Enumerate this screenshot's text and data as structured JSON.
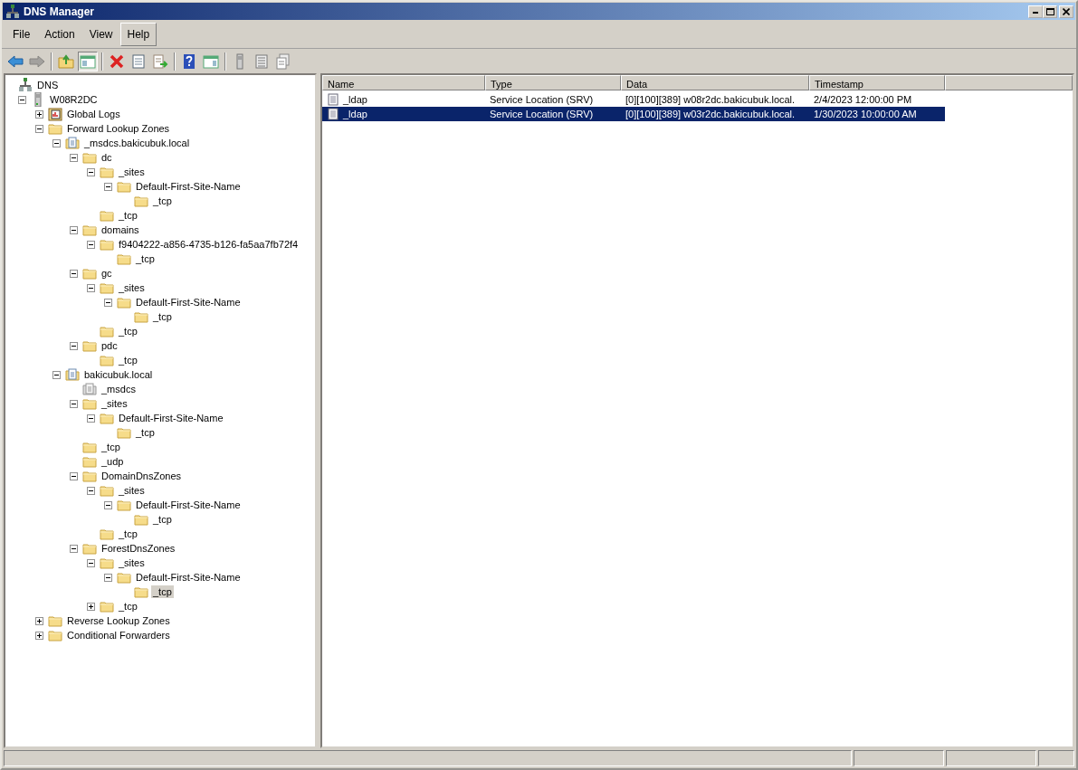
{
  "window": {
    "title": "DNS Manager"
  },
  "menu": [
    {
      "label": "File",
      "hot": false
    },
    {
      "label": "Action",
      "hot": false
    },
    {
      "label": "View",
      "hot": false
    },
    {
      "label": "Help",
      "hot": true
    }
  ],
  "toolbar": [
    {
      "kind": "back",
      "disabled": false,
      "pressed": false
    },
    {
      "kind": "forward",
      "disabled": true,
      "pressed": false
    },
    {
      "kind": "separator"
    },
    {
      "kind": "up",
      "disabled": false,
      "pressed": false
    },
    {
      "kind": "tree-toggle",
      "disabled": false,
      "pressed": true
    },
    {
      "kind": "separator"
    },
    {
      "kind": "delete",
      "disabled": false,
      "pressed": false
    },
    {
      "kind": "properties",
      "disabled": false,
      "pressed": false
    },
    {
      "kind": "export",
      "disabled": false,
      "pressed": false
    },
    {
      "kind": "separator"
    },
    {
      "kind": "help",
      "disabled": false,
      "pressed": false
    },
    {
      "kind": "action-pane",
      "disabled": false,
      "pressed": false
    },
    {
      "kind": "separator"
    },
    {
      "kind": "server",
      "disabled": false,
      "pressed": false
    },
    {
      "kind": "list",
      "disabled": false,
      "pressed": false
    },
    {
      "kind": "copy",
      "disabled": false,
      "pressed": false
    }
  ],
  "tree": [
    {
      "label": "DNS",
      "kind": "dns",
      "selected": false,
      "children": [
        {
          "label": "W08R2DC",
          "kind": "server",
          "expanded": true,
          "selected": false,
          "children": [
            {
              "label": "Global Logs",
              "kind": "logs",
              "expanded": false,
              "selected": false
            },
            {
              "label": "Forward Lookup Zones",
              "kind": "folder",
              "expanded": true,
              "selected": false,
              "children": [
                {
                  "label": "_msdcs.bakicubuk.local",
                  "kind": "zone",
                  "expanded": true,
                  "selected": false,
                  "children": [
                    {
                      "label": "dc",
                      "kind": "folder",
                      "expanded": true,
                      "selected": false,
                      "children": [
                        {
                          "label": "_sites",
                          "kind": "folder",
                          "expanded": true,
                          "selected": false,
                          "children": [
                            {
                              "label": "Default-First-Site-Name",
                              "kind": "folder",
                              "expanded": true,
                              "selected": false,
                              "children": [
                                {
                                  "label": "_tcp",
                                  "kind": "folder",
                                  "selected": false
                                }
                              ]
                            }
                          ]
                        },
                        {
                          "label": "_tcp",
                          "kind": "folder",
                          "selected": false
                        }
                      ]
                    },
                    {
                      "label": "domains",
                      "kind": "folder",
                      "expanded": true,
                      "selected": false,
                      "children": [
                        {
                          "label": "f9404222-a856-4735-b126-fa5aa7fb72f4",
                          "kind": "folder",
                          "expanded": true,
                          "selected": false,
                          "children": [
                            {
                              "label": "_tcp",
                              "kind": "folder",
                              "selected": false
                            }
                          ]
                        }
                      ]
                    },
                    {
                      "label": "gc",
                      "kind": "folder",
                      "expanded": true,
                      "selected": false,
                      "children": [
                        {
                          "label": "_sites",
                          "kind": "folder",
                          "expanded": true,
                          "selected": false,
                          "children": [
                            {
                              "label": "Default-First-Site-Name",
                              "kind": "folder",
                              "expanded": true,
                              "selected": false,
                              "children": [
                                {
                                  "label": "_tcp",
                                  "kind": "folder",
                                  "selected": false
                                }
                              ]
                            }
                          ]
                        },
                        {
                          "label": "_tcp",
                          "kind": "folder",
                          "selected": false
                        }
                      ]
                    },
                    {
                      "label": "pdc",
                      "kind": "folder",
                      "expanded": true,
                      "selected": false,
                      "children": [
                        {
                          "label": "_tcp",
                          "kind": "folder",
                          "selected": false
                        }
                      ]
                    }
                  ]
                },
                {
                  "label": "bakicubuk.local",
                  "kind": "zone",
                  "expanded": true,
                  "selected": false,
                  "children": [
                    {
                      "label": "_msdcs",
                      "kind": "zone-delegated",
                      "selected": false
                    },
                    {
                      "label": "_sites",
                      "kind": "folder",
                      "expanded": true,
                      "selected": false,
                      "children": [
                        {
                          "label": "Default-First-Site-Name",
                          "kind": "folder",
                          "expanded": true,
                          "selected": false,
                          "children": [
                            {
                              "label": "_tcp",
                              "kind": "folder",
                              "selected": false
                            }
                          ]
                        }
                      ]
                    },
                    {
                      "label": "_tcp",
                      "kind": "folder",
                      "selected": false
                    },
                    {
                      "label": "_udp",
                      "kind": "folder",
                      "selected": false
                    },
                    {
                      "label": "DomainDnsZones",
                      "kind": "folder",
                      "expanded": true,
                      "selected": false,
                      "children": [
                        {
                          "label": "_sites",
                          "kind": "folder",
                          "expanded": true,
                          "selected": false,
                          "children": [
                            {
                              "label": "Default-First-Site-Name",
                              "kind": "folder",
                              "expanded": true,
                              "selected": false,
                              "children": [
                                {
                                  "label": "_tcp",
                                  "kind": "folder",
                                  "selected": false
                                }
                              ]
                            }
                          ]
                        },
                        {
                          "label": "_tcp",
                          "kind": "folder",
                          "selected": false
                        }
                      ]
                    },
                    {
                      "label": "ForestDnsZones",
                      "kind": "folder",
                      "expanded": true,
                      "selected": false,
                      "children": [
                        {
                          "label": "_sites",
                          "kind": "folder",
                          "expanded": true,
                          "selected": false,
                          "children": [
                            {
                              "label": "Default-First-Site-Name",
                              "kind": "folder",
                              "expanded": true,
                              "selected": false,
                              "children": [
                                {
                                  "label": "_tcp",
                                  "kind": "folder",
                                  "selected": true
                                }
                              ]
                            }
                          ]
                        },
                        {
                          "label": "_tcp",
                          "kind": "folder",
                          "expanded": false,
                          "selected": false
                        }
                      ]
                    }
                  ]
                }
              ]
            },
            {
              "label": "Reverse Lookup Zones",
              "kind": "folder",
              "expanded": false,
              "selected": false
            },
            {
              "label": "Conditional Forwarders",
              "kind": "folder",
              "expanded": false,
              "selected": false
            }
          ]
        }
      ]
    }
  ],
  "table": {
    "columns": [
      "Name",
      "Type",
      "Data",
      "Timestamp"
    ],
    "rows": [
      {
        "cells": [
          "_ldap",
          "Service Location (SRV)",
          "[0][100][389] w08r2dc.bakicubuk.local.",
          "2/4/2023 12:00:00 PM"
        ],
        "selected": false
      },
      {
        "cells": [
          "_ldap",
          "Service Location (SRV)",
          "[0][100][389] w03r2dc.bakicubuk.local.",
          "1/30/2023 10:00:00 AM"
        ],
        "selected": true
      }
    ]
  }
}
